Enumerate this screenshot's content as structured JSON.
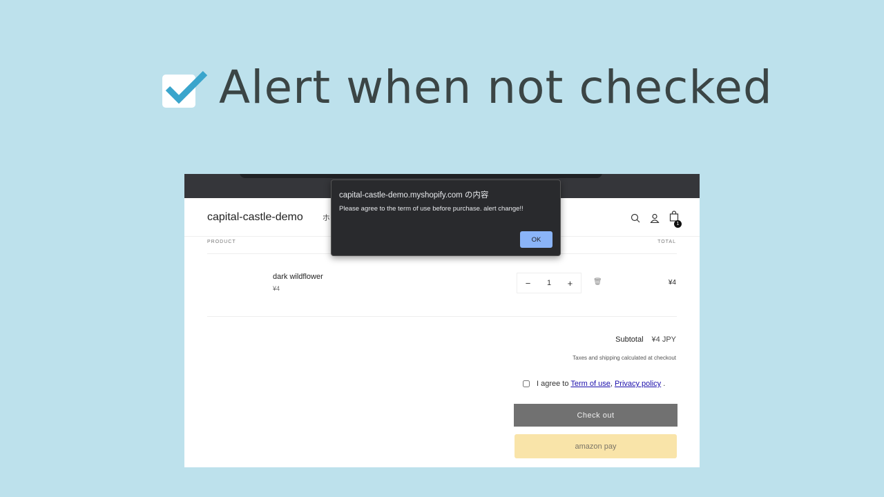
{
  "headline": {
    "text": "Alert when not checked",
    "icon": "checkbox-checked-icon",
    "accent": "#3aa5cc"
  },
  "store": {
    "name": "capital-castle-demo",
    "nav_partial": "ホ",
    "cart_count": "1"
  },
  "cart": {
    "columns": {
      "product": "PRODUCT",
      "total": "TOTAL"
    },
    "item": {
      "name": "dark wildflower",
      "price": "¥4",
      "quantity": "1",
      "minus": "−",
      "plus": "+",
      "total": "¥4"
    },
    "subtotal_label": "Subtotal",
    "subtotal_value": "¥4 JPY",
    "tax_note": "Taxes and shipping calculated at checkout",
    "agree": {
      "prefix": "I agree to",
      "terms": "Term of use",
      "separator": ",",
      "privacy": "Privacy policy",
      "suffix": ".",
      "checked": false
    },
    "checkout_label": "Check out",
    "amazon_label": "amazon pay"
  },
  "dialog": {
    "title": "capital-castle-demo.myshopify.com の内容",
    "message": "Please agree to the term of use before purchase. alert change!!",
    "ok_label": "OK"
  }
}
